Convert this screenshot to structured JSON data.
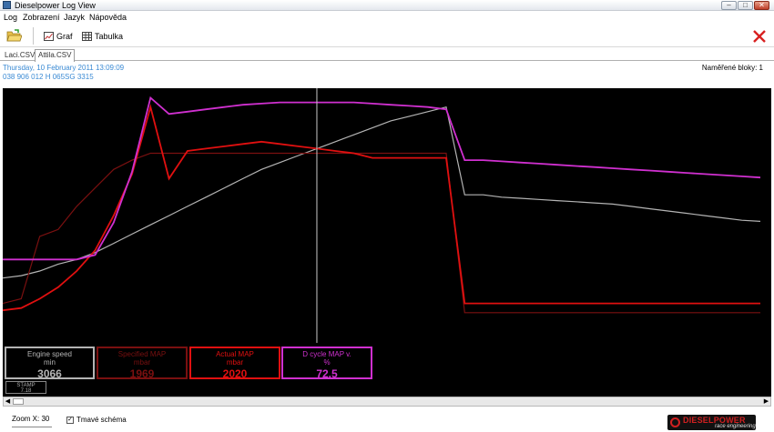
{
  "window": {
    "title": "Dieselpower Log View"
  },
  "menu": [
    "Log",
    "Zobrazení",
    "Jazyk",
    "Nápověda"
  ],
  "toolbar": {
    "graph_label": "Graf",
    "table_label": "Tabulka"
  },
  "tabs": [
    {
      "label": "Laci.CSV",
      "active": false
    },
    {
      "label": "Attila.CSV",
      "active": true
    }
  ],
  "info": {
    "date": "Thursday, 10 February 2011 13:09:09",
    "ecu": "038 906 012 H   065SG   3315",
    "blocks": "Naměřené bloky: 1"
  },
  "colors": {
    "engine_speed": "#b4b4b4",
    "specified_map": "#7a1010",
    "actual_map": "#e01010",
    "duty_cycle": "#d030d0",
    "cursor": "#c8c8c8"
  },
  "chart_data": {
    "type": "line",
    "background": "black",
    "grid": false,
    "cursor_index": 17,
    "series": [
      {
        "name": "Engine speed",
        "unit": "min",
        "current": "3066",
        "values": [
          0.21,
          0.22,
          0.24,
          0.27,
          0.29,
          0.32,
          0.36,
          0.4,
          0.44,
          0.48,
          0.52,
          0.56,
          0.6,
          0.64,
          0.68,
          0.71,
          0.74,
          0.77,
          0.8,
          0.83,
          0.86,
          0.89,
          0.91,
          0.93,
          0.95,
          0.57,
          0.57,
          0.56,
          0.555,
          0.55,
          0.545,
          0.54,
          0.535,
          0.53,
          0.52,
          0.51,
          0.5,
          0.49,
          0.48,
          0.47,
          0.46,
          0.455
        ]
      },
      {
        "name": "Specified MAP",
        "unit": "mbar",
        "current": "1969",
        "values": [
          0.1,
          0.12,
          0.39,
          0.42,
          0.52,
          0.6,
          0.68,
          0.72,
          0.75,
          0.75,
          0.75,
          0.75,
          0.75,
          0.75,
          0.75,
          0.75,
          0.75,
          0.75,
          0.75,
          0.75,
          0.75,
          0.75,
          0.75,
          0.75,
          0.75,
          0.06,
          0.06,
          0.06,
          0.06,
          0.06,
          0.06,
          0.06,
          0.06,
          0.06,
          0.06,
          0.06,
          0.06,
          0.06,
          0.06,
          0.06,
          0.06,
          0.06
        ]
      },
      {
        "name": "Actual MAP",
        "unit": "mbar",
        "current": "2020",
        "values": [
          0.07,
          0.08,
          0.12,
          0.17,
          0.24,
          0.33,
          0.48,
          0.66,
          0.95,
          0.64,
          0.76,
          0.77,
          0.78,
          0.79,
          0.8,
          0.79,
          0.78,
          0.77,
          0.76,
          0.75,
          0.73,
          0.73,
          0.73,
          0.73,
          0.73,
          0.1,
          0.1,
          0.1,
          0.1,
          0.1,
          0.1,
          0.1,
          0.1,
          0.1,
          0.1,
          0.1,
          0.1,
          0.1,
          0.1,
          0.1,
          0.1,
          0.1
        ]
      },
      {
        "name": "D cycle MAP v.",
        "unit": "%",
        "current": "72.5",
        "values": [
          0.29,
          0.29,
          0.29,
          0.29,
          0.29,
          0.31,
          0.45,
          0.67,
          0.99,
          0.92,
          0.93,
          0.94,
          0.95,
          0.96,
          0.965,
          0.97,
          0.97,
          0.97,
          0.97,
          0.97,
          0.965,
          0.96,
          0.955,
          0.95,
          0.94,
          0.72,
          0.72,
          0.715,
          0.71,
          0.705,
          0.7,
          0.695,
          0.69,
          0.685,
          0.68,
          0.675,
          0.67,
          0.665,
          0.66,
          0.655,
          0.65,
          0.645
        ]
      }
    ]
  },
  "value_boxes": [
    {
      "title": "Engine speed",
      "unit": "min",
      "value": "3066"
    },
    {
      "title": "Specified MAP",
      "unit": "mbar",
      "value": "1969"
    },
    {
      "title": "Actual MAP",
      "unit": "mbar",
      "value": "2020"
    },
    {
      "title": "D cycle MAP v.",
      "unit": "%",
      "value": "72.5"
    }
  ],
  "stamp": {
    "label": "STAMP",
    "value": "7.18"
  },
  "status": {
    "zoom": "Zoom X: 30",
    "dark_scheme": "Tmavé schéma",
    "dark_scheme_checked": true
  },
  "logo": {
    "brand": "DIESELPOWER",
    "tagline": "race engineering"
  }
}
